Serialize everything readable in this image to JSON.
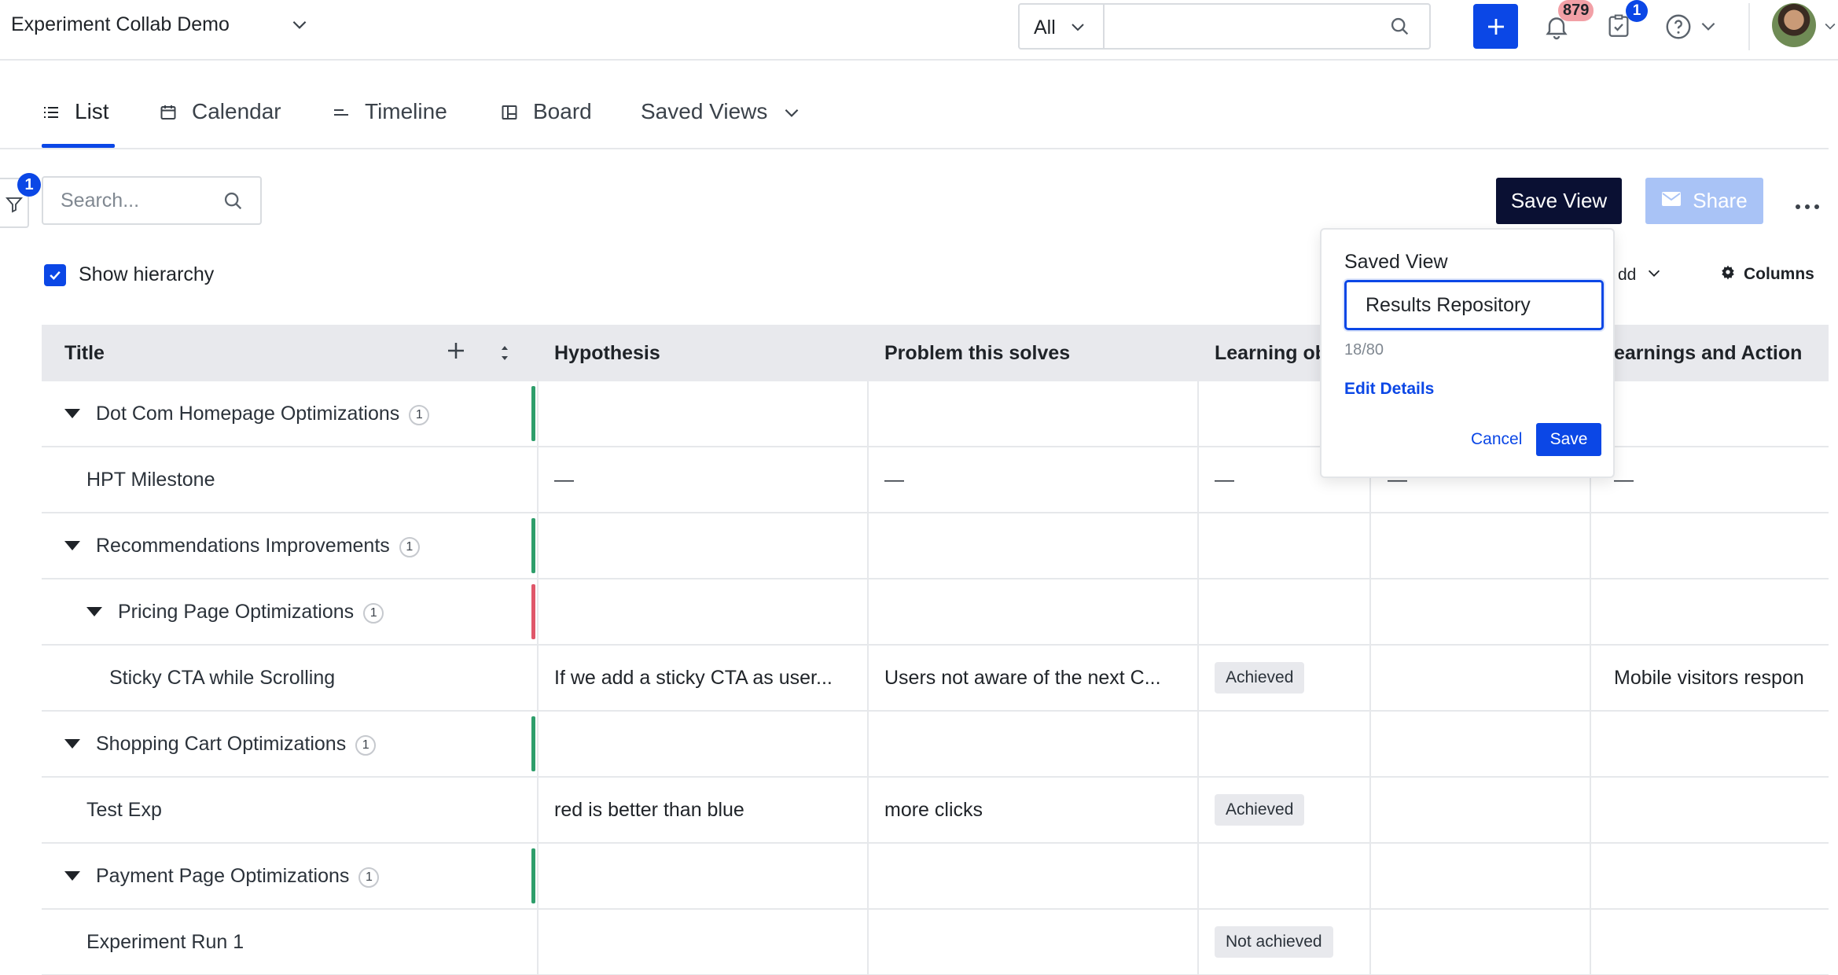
{
  "header": {
    "project_name": "Experiment Collab Demo",
    "scope_label": "All",
    "search_value": "",
    "notifications_count": "879",
    "tasks_count": "1"
  },
  "tabs": [
    {
      "label": "List",
      "icon": "list-icon",
      "active": true
    },
    {
      "label": "Calendar",
      "icon": "calendar-icon",
      "active": false
    },
    {
      "label": "Timeline",
      "icon": "timeline-icon",
      "active": false
    },
    {
      "label": "Board",
      "icon": "board-icon",
      "active": false
    },
    {
      "label": "Saved Views",
      "icon": "chevron-down-icon",
      "active": false
    }
  ],
  "toolbar": {
    "filter_count": "1",
    "search_placeholder": "Search...",
    "save_view_label": "Save View",
    "share_label": "Share",
    "show_hierarchy_label": "Show hierarchy",
    "show_hierarchy_checked": true,
    "add_label": "dd",
    "columns_label": "Columns"
  },
  "table": {
    "columns": [
      "Title",
      "Hypothesis",
      "Problem this solves",
      "Learning ob",
      "",
      "earnings and Action"
    ],
    "rows": [
      {
        "title": "Dot Com Homepage Optimizations",
        "count": "1",
        "level": 0,
        "expandable": true,
        "status_color": "#2e9e6b",
        "hypothesis": "",
        "problem": "",
        "learning": "",
        "col5": "",
        "learnings_action": ""
      },
      {
        "title": "HPT Milestone",
        "count": "",
        "level": 1,
        "expandable": false,
        "status_color": "",
        "hypothesis": "—",
        "problem": "—",
        "learning": "—",
        "col5": "—",
        "learnings_action": "—"
      },
      {
        "title": "Recommendations Improvements",
        "count": "1",
        "level": 0,
        "expandable": true,
        "status_color": "#2e9e6b",
        "hypothesis": "",
        "problem": "",
        "learning": "",
        "col5": "",
        "learnings_action": ""
      },
      {
        "title": "Pricing Page Optimizations",
        "count": "1",
        "level": 1,
        "expandable": true,
        "status_color": "#e0576a",
        "hypothesis": "",
        "problem": "",
        "learning": "",
        "col5": "",
        "learnings_action": ""
      },
      {
        "title": "Sticky CTA while Scrolling",
        "count": "",
        "level": 2,
        "expandable": false,
        "status_color": "",
        "hypothesis": "If we add a sticky CTA as user...",
        "problem": "Users not aware of the next C...",
        "learning": "Achieved",
        "col5": "",
        "learnings_action": "Mobile visitors respon"
      },
      {
        "title": "Shopping Cart Optimizations",
        "count": "1",
        "level": 0,
        "expandable": true,
        "status_color": "#2e9e6b",
        "hypothesis": "",
        "problem": "",
        "learning": "",
        "col5": "",
        "learnings_action": ""
      },
      {
        "title": "Test Exp",
        "count": "",
        "level": 1,
        "expandable": false,
        "status_color": "",
        "hypothesis": "red is better than blue",
        "problem": "more clicks",
        "learning": "Achieved",
        "col5": "",
        "learnings_action": ""
      },
      {
        "title": "Payment Page Optimizations",
        "count": "1",
        "level": 0,
        "expandable": true,
        "status_color": "#2e9e6b",
        "hypothesis": "",
        "problem": "",
        "learning": "",
        "col5": "",
        "learnings_action": ""
      },
      {
        "title": "Experiment Run 1",
        "count": "",
        "level": 1,
        "expandable": false,
        "status_color": "",
        "hypothesis": "",
        "problem": "",
        "learning": "Not achieved",
        "col5": "",
        "learnings_action": ""
      }
    ]
  },
  "popover": {
    "title": "Saved View",
    "input_value": "Results Repository",
    "char_count": "18/80",
    "edit_details_label": "Edit Details",
    "cancel_label": "Cancel",
    "save_label": "Save"
  },
  "colors": {
    "accent": "#0b47e6",
    "save_view_bg": "#0a1033",
    "share_disabled_bg": "#a9c3f6",
    "status_green": "#2e9e6b",
    "status_red": "#e0576a"
  }
}
